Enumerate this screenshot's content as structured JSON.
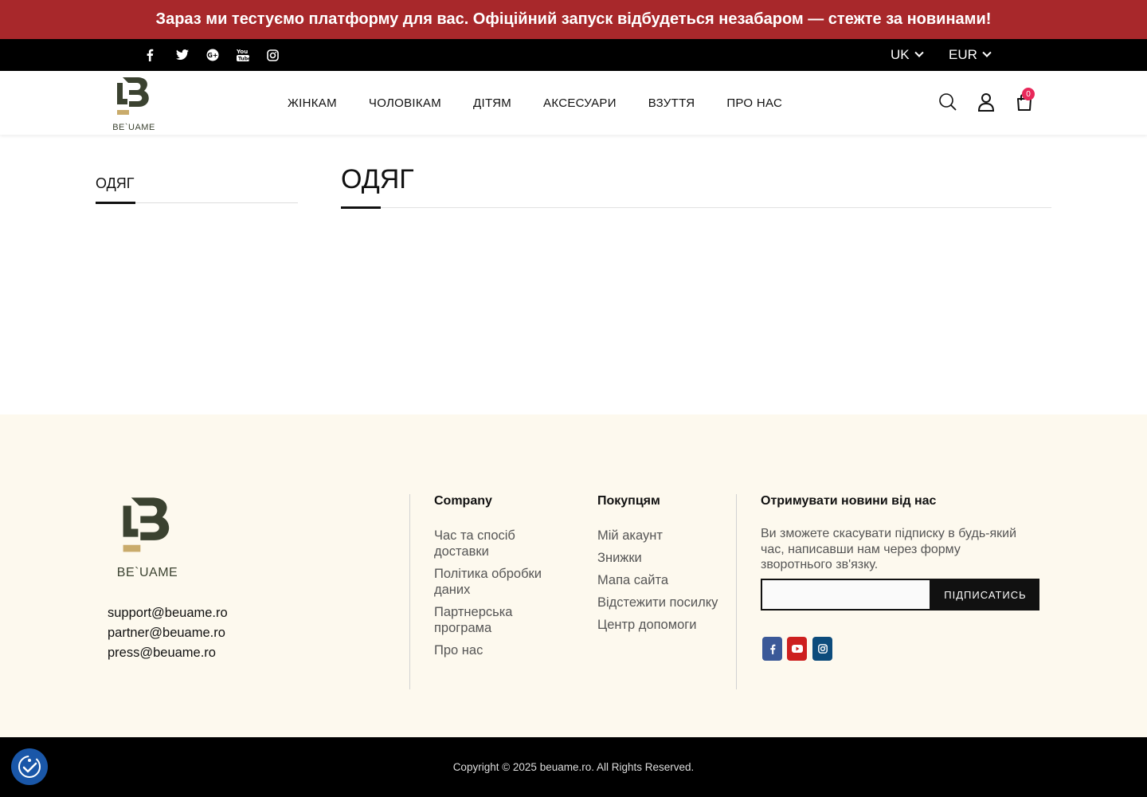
{
  "announcement": "Зараз ми тестуємо платформу для вас. Офіційний запуск відбудеться незабаром — стежте за новинами!",
  "topbar": {
    "social": [
      "facebook-icon",
      "twitter-icon",
      "google-plus-icon",
      "youtube-icon",
      "instagram-icon"
    ],
    "language": "UK",
    "currency": "EUR"
  },
  "header": {
    "logo_text": "BE`UAME",
    "nav": [
      "ЖІНКАМ",
      "ЧОЛОВІКАМ",
      "ДІТЯМ",
      "АКСЕСУАРИ",
      "ВЗУТТЯ",
      "ПРО НАС"
    ],
    "cart_count": "0"
  },
  "sidebar": {
    "title": "ОДЯГ"
  },
  "main": {
    "title": "ОДЯГ"
  },
  "footer": {
    "logo_text": "BE`UAME",
    "emails": [
      "support@beuame.ro",
      "partner@beuame.ro",
      "press@beuame.ro"
    ],
    "company": {
      "title": "Company",
      "links": [
        "Час та спосіб доставки",
        "Політика обробки даних",
        "Партнерська програма",
        "Про нас"
      ]
    },
    "customers": {
      "title": "Покупцям",
      "links": [
        "Мій акаунт",
        "Знижки",
        "Мапа сайта",
        "Відстежити посилку",
        "Центр допомоги"
      ]
    },
    "newsletter": {
      "title": "Отримувати новини від нас",
      "text": "Ви зможете скасувати підписку в будь-який час, написавши нам через форму зворотнього зв'язку.",
      "button": "ПІДПИСАТИСЬ"
    },
    "social": [
      {
        "icon": "facebook-icon",
        "color": "#3b5998"
      },
      {
        "icon": "youtube-icon",
        "color": "#cd201f"
      },
      {
        "icon": "instagram-icon",
        "color": "#0d4c7c"
      }
    ]
  },
  "copyright": "Copyright © 2025 beuame.ro. All Rights Reserved.",
  "colors": {
    "announce_bg": "#a8282b",
    "logo_green": "#3b4230",
    "logo_gold": "#c9ab6b",
    "cart_badge": "#e8285a",
    "footer_bg": "#fdf9ee"
  }
}
